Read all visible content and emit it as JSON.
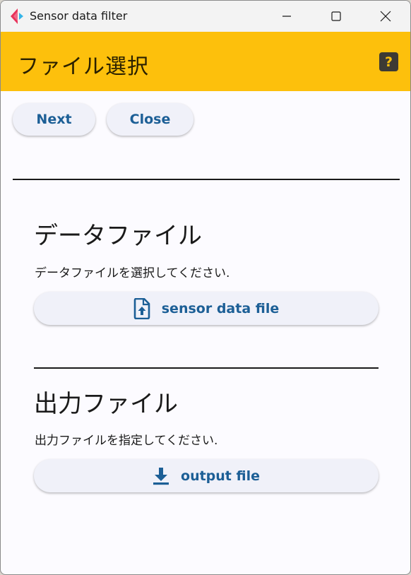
{
  "window": {
    "title": "Sensor data filter"
  },
  "appbar": {
    "title": "ファイル選択",
    "help_label": "?"
  },
  "toolbar": {
    "next_label": "Next",
    "close_label": "Close"
  },
  "sections": [
    {
      "heading": "データファイル",
      "description": "データファイルを選択してください.",
      "button_label": "sensor data file",
      "icon": "file-upload-icon"
    },
    {
      "heading": "出力ファイル",
      "description": "出力ファイルを指定してください.",
      "button_label": "output file",
      "icon": "download-icon"
    }
  ],
  "colors": {
    "appbar": "#fdc00c",
    "accent": "#1c5f96",
    "button_bg": "#f0f1f9",
    "background": "#fcfbff"
  }
}
